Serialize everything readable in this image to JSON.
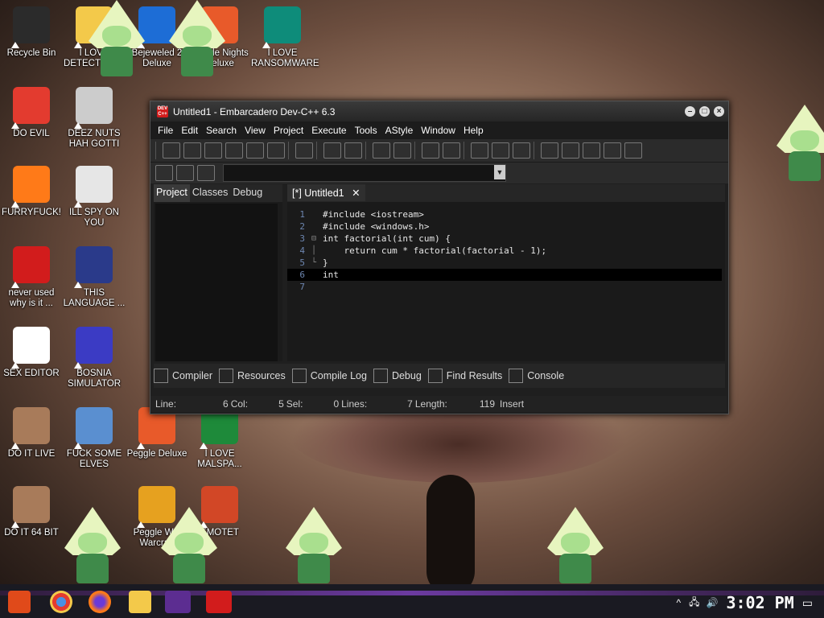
{
  "desktop": {
    "icons": [
      {
        "label": "Recycle Bin",
        "color": "#2b2b2b"
      },
      {
        "label": "I LOVE DETECTING...",
        "color": "#f3c94a"
      },
      {
        "label": "Bejeweled 2 Deluxe",
        "color": "#1d6dd6"
      },
      {
        "label": "Peggle Nights Deluxe",
        "color": "#e85a2a"
      },
      {
        "label": "I LOVE RANSOMWARE",
        "color": "#0e8c7a"
      },
      {
        "label": "DO EVIL",
        "color": "#e33b2f"
      },
      {
        "label": "DEEZ NUTS HAH GOTTI",
        "color": "#cccccc"
      },
      {
        "label": "FURRYFUCK!",
        "color": "#ff7a18"
      },
      {
        "label": "ILL SPY ON YOU",
        "color": "#e6e6e6"
      },
      {
        "label": "never used why is it ...",
        "color": "#d21c1c"
      },
      {
        "label": "THIS LANGUAGE ...",
        "color": "#2a3a8a"
      },
      {
        "label": "SEX EDITOR",
        "color": "#ffffff"
      },
      {
        "label": "BOSNIA SIMULATOR",
        "color": "#3b3bc4"
      },
      {
        "label": "DO IT LIVE",
        "color": "#a87b5a"
      },
      {
        "label": "FUCK SOME ELVES",
        "color": "#5a8fd0"
      },
      {
        "label": "Peggle Deluxe",
        "color": "#e85a2a"
      },
      {
        "label": "I LOVE MALSPA...",
        "color": "#1e8a3a"
      },
      {
        "label": "DO IT 64 BIT",
        "color": "#a87b5a"
      },
      {
        "label": "Peggle W... Warcraft",
        "color": "#e6a11f"
      },
      {
        "label": "EMOTET",
        "color": "#d24726"
      }
    ]
  },
  "window": {
    "title": "Untitled1 - Embarcadero Dev-C++ 6.3",
    "app_icon_text": "DEV C++",
    "menu": [
      "File",
      "Edit",
      "Search",
      "View",
      "Project",
      "Execute",
      "Tools",
      "AStyle",
      "Window",
      "Help"
    ],
    "left_tabs": [
      "Project",
      "Classes",
      "Debug"
    ],
    "editor_tab": "[*] Untitled1",
    "code_lines": [
      {
        "n": "1",
        "text": "#include <iostream>"
      },
      {
        "n": "2",
        "text": "#include <windows.h>"
      },
      {
        "n": "3",
        "text": "int factorial(int cum) {"
      },
      {
        "n": "4",
        "text": "    return cum * factorial(factorial - 1);"
      },
      {
        "n": "5",
        "text": "}"
      },
      {
        "n": "6",
        "text": "int"
      },
      {
        "n": "7",
        "text": ""
      }
    ],
    "bottom_tabs": [
      "Compiler",
      "Resources",
      "Compile Log",
      "Debug",
      "Find Results",
      "Console"
    ],
    "status": {
      "line_label": "Line:",
      "line": "6",
      "col_label": "Col:",
      "col": "5",
      "sel_label": "Sel:",
      "sel": "0",
      "lines_label": "Lines:",
      "lines": "7",
      "length_label": "Length:",
      "length": "119",
      "mode": "Insert"
    }
  },
  "taskbar": {
    "clock": "3:02 PM"
  }
}
